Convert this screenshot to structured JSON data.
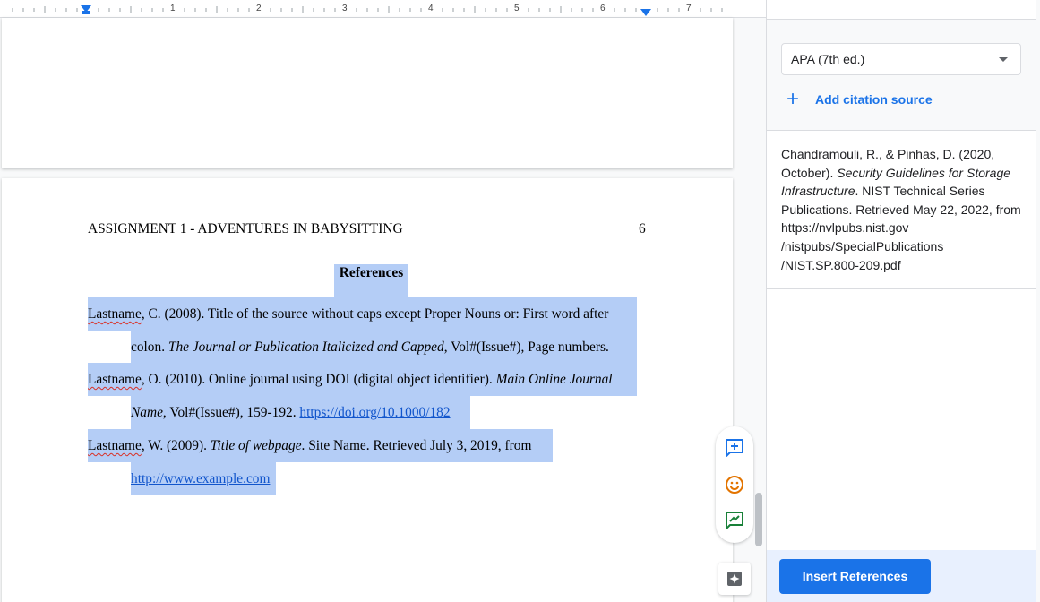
{
  "ruler": {
    "numbers": [
      "1",
      "2",
      "3",
      "4",
      "5",
      "6",
      "7"
    ]
  },
  "document": {
    "running_head": "ASSIGNMENT 1 - ADVENTURES IN BABYSITTING",
    "page_number": "6",
    "heading": "References",
    "refs": [
      {
        "l1_author": "Lastname",
        "l1_rest": ", C. (2008). Title of the source without caps except Proper Nouns or: First word after",
        "l2_plain": "colon. ",
        "l2_italic": "The Journal or Publication Italicized and Capped",
        "l2_rest": ", Vol#(Issue#), Page numbers."
      },
      {
        "l1_author": "Lastname",
        "l1_rest": ", O. (2010). Online journal using DOI (digital object identifier). ",
        "l1_italic": "Main Online Journal",
        "l2_italic": "Name",
        "l2_rest": ", Vol#(Issue#), 159-192. ",
        "l2_link": "https://doi.org/10.1000/182"
      },
      {
        "l1_author": "Lastname",
        "l1_rest": ", W. (2009). ",
        "l1_italic": "Title of webpage",
        "l1_rest2": ". Site Name. Retrieved July 3, 2019, from",
        "l2_link": "http://www.example.com"
      }
    ]
  },
  "panel": {
    "style_select": "APA (7th ed.)",
    "add_source_label": "Add citation source",
    "citation": {
      "part1": "Chandramouli, R., & Pinhas, D. (2020, October). ",
      "title_italic": "Security Guidelines for Storage Infrastructure",
      "part2": ". NIST Technical Series Publications. Retrieved May 22, 2022, from https://nvlpubs.nist.gov /nistpubs/SpecialPublications /NIST.SP.800-209.pdf"
    },
    "insert_button": "Insert References"
  },
  "colors": {
    "accent": "#1a73e8",
    "selection": "#b4cdf6",
    "link": "#1155cc"
  },
  "icons": [
    "add-comment-icon",
    "emoji-icon",
    "suggest-edit-icon",
    "explore-icon",
    "plus-icon",
    "chevron-down-icon"
  ]
}
